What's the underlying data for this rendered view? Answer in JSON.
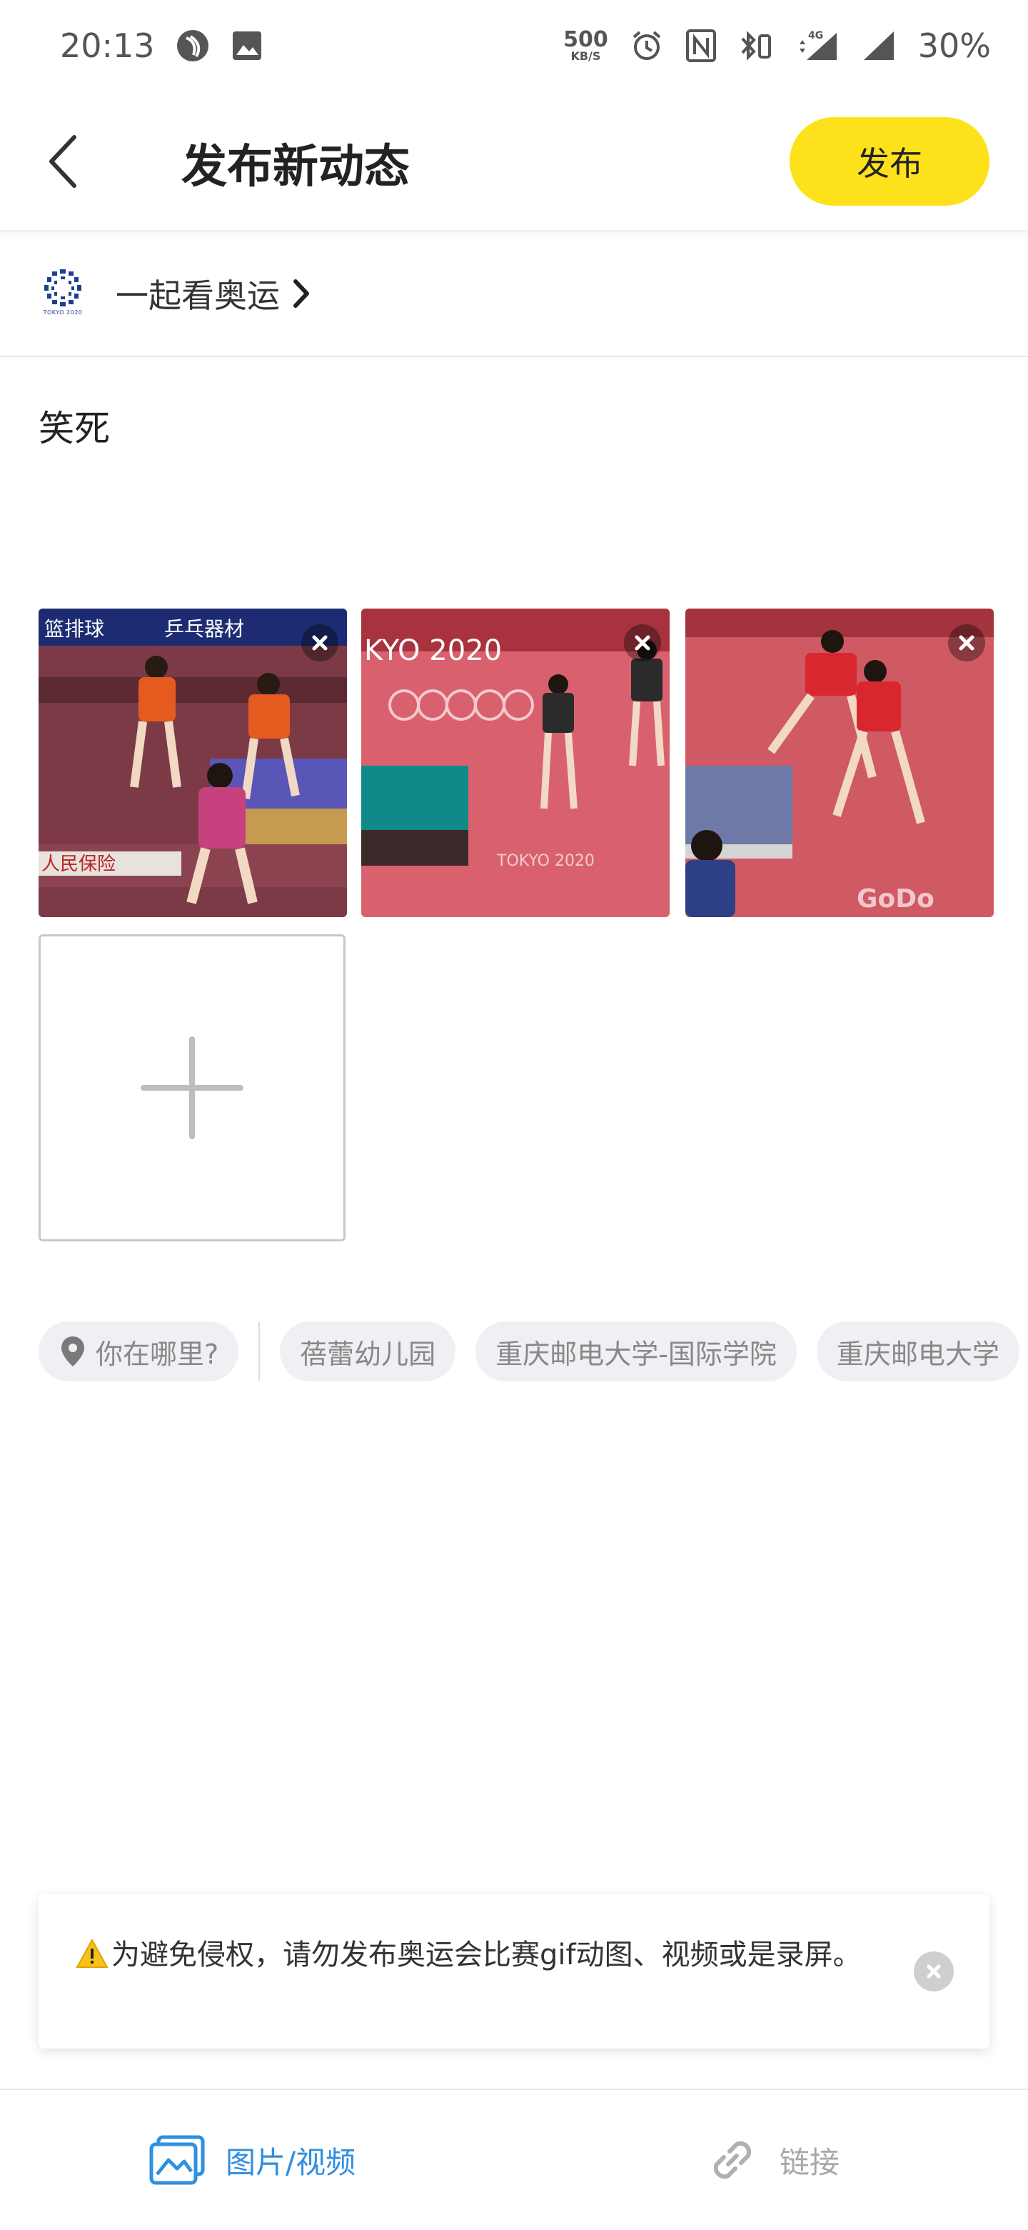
{
  "status_bar": {
    "time": "20:13",
    "speed_value": "500",
    "speed_unit": "KB/S",
    "network": "4G",
    "battery": "30%"
  },
  "header": {
    "title": "发布新动态",
    "publish_label": "发布"
  },
  "topic": {
    "label": "一起看奥运",
    "logo_text": "TOKYO 2020"
  },
  "post": {
    "text": "笑死"
  },
  "photos": [
    {
      "caption_top": "篮排球",
      "caption_brand": "乒乓器材",
      "caption_bottom": "人民保险"
    },
    {
      "caption_top": "KYO 2020",
      "caption_bottom": "TOKYO 2020"
    },
    {
      "caption_top": "",
      "caption_bottom": "GoDo"
    }
  ],
  "location": {
    "prompt": "你在哪里?",
    "suggestions": [
      "蓓蕾幼儿园",
      "重庆邮电大学-国际学院",
      "重庆邮电大学"
    ]
  },
  "warning": {
    "emoji": "⚠️",
    "text": "为避免侵权，请勿发布奥运会比赛gif动图、视频或是录屏。"
  },
  "bottom_tabs": {
    "media_label": "图片/视频",
    "link_label": "链接",
    "active_color": "#2f8fe0",
    "inactive_color": "#a8a8a8"
  },
  "colors": {
    "publish_button": "#fde21b"
  }
}
